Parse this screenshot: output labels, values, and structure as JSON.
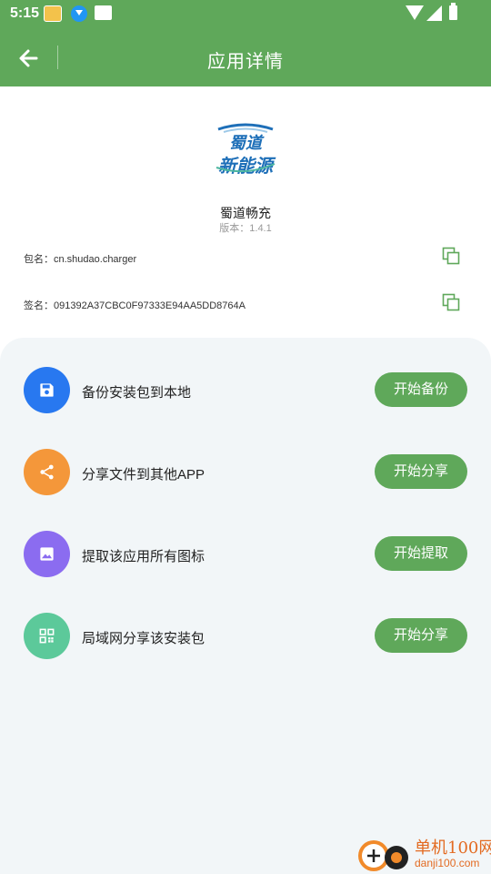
{
  "status_bar": {
    "time": "5:15"
  },
  "header": {
    "title": "应用详情"
  },
  "app": {
    "logo_text_top": "蜀道",
    "logo_text_bottom": "新能源",
    "name": "蜀道畅充",
    "version_label": "版本：",
    "version": "1.4.1",
    "package_label": "包名：",
    "package": "cn.shudao.charger",
    "sign_label": "签名：",
    "sign": "091392A37CBC0F97333E94AA5DD8764A"
  },
  "actions": [
    {
      "label": "备份安装包到本地",
      "button": "开始备份",
      "icon": "save-icon",
      "color": "#2878f0"
    },
    {
      "label": "分享文件到其他APP",
      "button": "开始分享",
      "icon": "share-icon",
      "color": "#f4973a"
    },
    {
      "label": "提取该应用所有图标",
      "button": "开始提取",
      "icon": "image-icon",
      "color": "#8b6cf0"
    },
    {
      "label": "局域网分享该安装包",
      "button": "开始分享",
      "icon": "qr-code-icon",
      "color": "#5cc99a"
    }
  ],
  "watermark": {
    "line1": "单机100网",
    "line2": "danji100.com"
  },
  "colors": {
    "primary": "#5fa85a",
    "panel_bg": "#f2f6f8"
  }
}
